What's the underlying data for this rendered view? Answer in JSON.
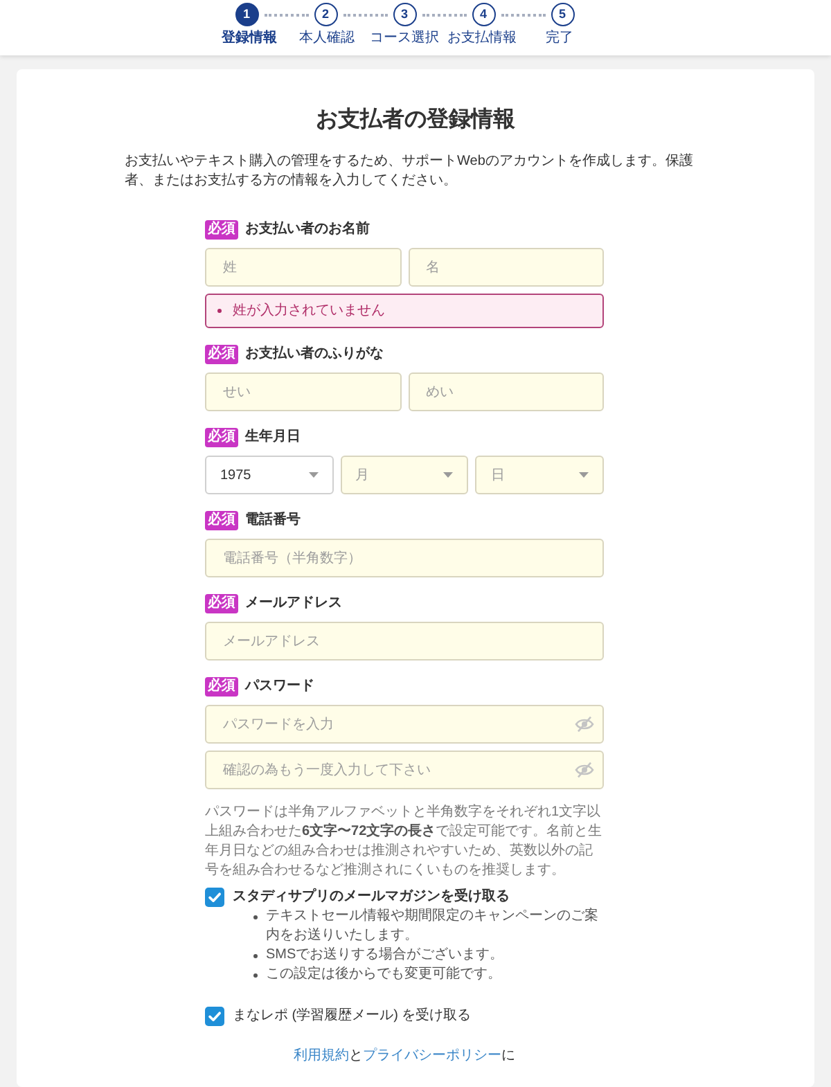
{
  "steps": [
    {
      "number": "1",
      "label": "登録情報",
      "selected": true
    },
    {
      "number": "2",
      "label": "本人確認",
      "selected": false
    },
    {
      "number": "3",
      "label": "コース選択",
      "selected": false
    },
    {
      "number": "4",
      "label": "お支払情報",
      "selected": false
    },
    {
      "number": "5",
      "label": "完了",
      "selected": false
    }
  ],
  "title": "お支払者の登録情報",
  "description": "お支払いやテキスト購入の管理をするため、サポートWebのアカウントを作成します。保護者、またはお支払する方の情報を入力してください。",
  "fields": [
    {
      "kind": "pair",
      "badge": "必須",
      "label": "お支払い者のお名前",
      "inputs": [
        {
          "placeholder": "姓"
        },
        {
          "placeholder": "名"
        }
      ],
      "errors": [
        "姓が入力されていません"
      ]
    },
    {
      "kind": "pair",
      "badge": "必須",
      "label": "お支払い者のふりがな",
      "inputs": [
        {
          "placeholder": "せい"
        },
        {
          "placeholder": "めい"
        }
      ]
    },
    {
      "kind": "selects",
      "badge": "必須",
      "label": "生年月日",
      "selects": [
        {
          "value": "1975"
        },
        {
          "placeholder": "月"
        },
        {
          "placeholder": "日"
        }
      ]
    },
    {
      "kind": "text",
      "badge": "必須",
      "label": "電話番号",
      "inputs": [
        {
          "placeholder": "電話番号（半角数字）"
        }
      ]
    },
    {
      "kind": "text",
      "badge": "必須",
      "label": "メールアドレス",
      "inputs": [
        {
          "placeholder": "メールアドレス"
        }
      ]
    },
    {
      "kind": "password",
      "badge": "必須",
      "label": "パスワード",
      "inputs": [
        {
          "placeholder": "パスワードを入力"
        },
        {
          "placeholder": "確認の為もう一度入力して下さい"
        }
      ]
    }
  ],
  "password_note": "パスワードは半角アルファベットと半角数字をそれぞれ1文字以上組み合わせた**6文字〜72文字の長さ**で設定可能です。名前と生年月日などの組み合わせは推測されやすいため、英数以外の記号を組み合わせるなど推測されにくいものを推奨します。",
  "options": [
    {
      "label": "スタディサプリのメールマガジンを受け取る",
      "checked": true,
      "emphasized": true,
      "notes": [
        "テキストセール情報や期間限定のキャンペーンのご案内をお送りいたします。",
        "SMSでお送りする場合がございます。",
        "この設定は後からでも変更可能です。"
      ]
    },
    {
      "label": "まなレポ (学習履歴メール) を受け取る",
      "checked": true,
      "emphasized": false
    }
  ],
  "terms_line": [
    {
      "kind": "link",
      "text": "利用規約"
    },
    {
      "kind": "text",
      "text": "と"
    },
    {
      "kind": "link",
      "text": "プライバシーポリシー"
    },
    {
      "kind": "text",
      "text": "に"
    }
  ]
}
